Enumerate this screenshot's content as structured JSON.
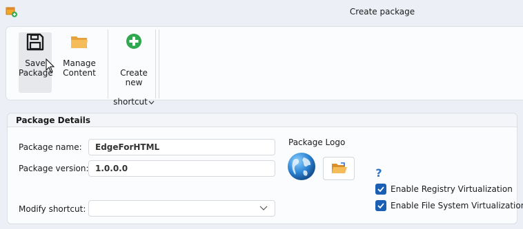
{
  "window": {
    "title": "Create package",
    "app_icon": "package-app-icon"
  },
  "ribbon": {
    "save_label": "Save\nPackage",
    "save_icon": "floppy-disk-icon",
    "manage_label": "Manage\nContent",
    "manage_icon": "folder-icon",
    "shortcut_label_line1": "Create new",
    "shortcut_label_line2": "shortcut",
    "shortcut_icon": "green-plus-icon"
  },
  "package_details": {
    "header": "Package Details",
    "name_label": "Package name:",
    "name_value": "EdgeForHTML",
    "version_label": "Package version:",
    "version_value": "1.0.0.0",
    "modify_shortcut_label": "Modify shortcut:",
    "modify_shortcut_value": "",
    "logo_label": "Package Logo",
    "logo_icon": "globe-icon",
    "browse_icon": "open-folder-icon",
    "help_icon": "question-mark-icon",
    "registry_virtualization_label": "Enable Registry Virtualization",
    "registry_virtualization_checked": true,
    "filesystem_virtualization_label": "Enable File System Virtualization",
    "filesystem_virtualization_checked": true
  },
  "colors": {
    "accent": "#1a5fb4",
    "window_bg": "#ecf0f6",
    "panel_bg": "#fbfcfd"
  }
}
